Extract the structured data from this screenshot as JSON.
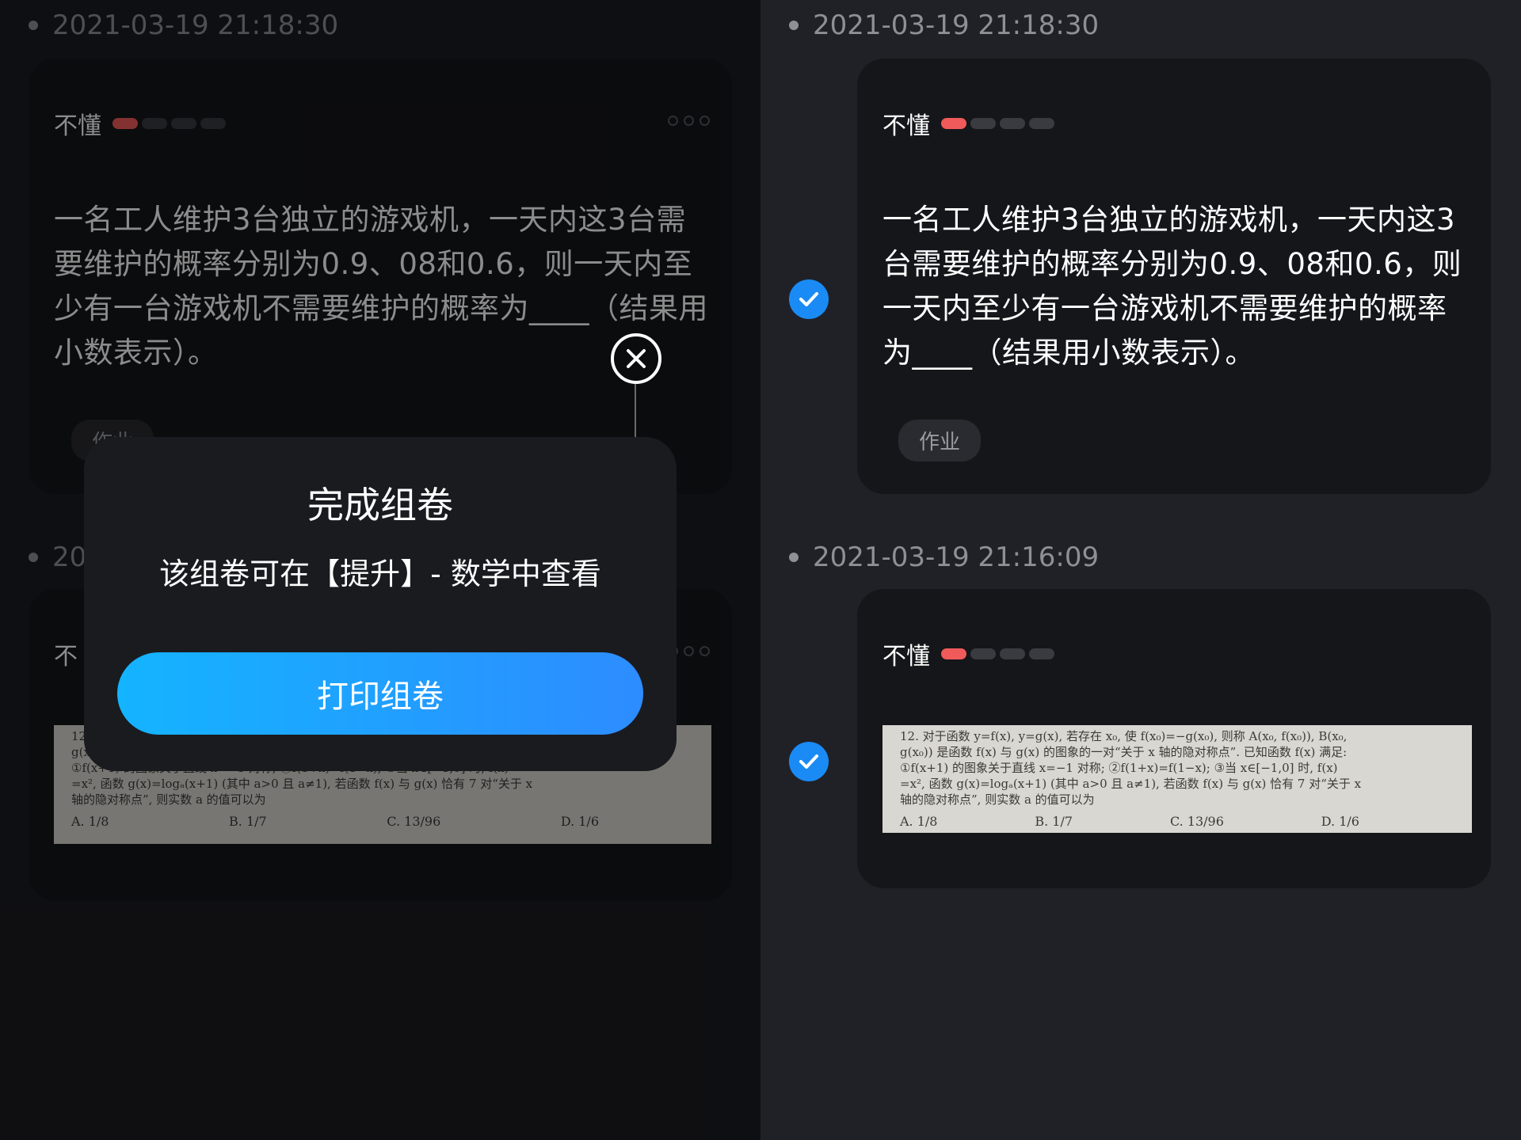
{
  "left": {
    "entry1": {
      "timestamp": "2021-03-19 21:18:30",
      "status_label": "不懂",
      "question": "一名工人维护3台独立的游戏机，一天内这3台需要维护的概率分别为0.9、08和0.6，则一天内至少有一台游戏机不需要维护的概率为____（结果用小数表示）。",
      "tag": "作业"
    },
    "entry2": {
      "timestamp_partial": "20",
      "status_label_partial": "不"
    }
  },
  "dialog": {
    "title": "完成组卷",
    "message": "该组卷可在【提升】- 数学中查看",
    "button": "打印组卷",
    "close_icon": "close-circle-icon"
  },
  "right": {
    "entry1": {
      "timestamp": "2021-03-19 21:18:30",
      "status_label": "不懂",
      "question": "一名工人维护3台独立的游戏机，一天内这3台需要维护的概率分别为0.9、08和0.6，则一天内至少有一台游戏机不需要维护的概率为____（结果用小数表示）。",
      "tag": "作业",
      "checked": true
    },
    "entry2": {
      "timestamp": "2021-03-19 21:16:09",
      "status_label": "不懂",
      "checked": true,
      "photo": {
        "line1": "12. 对于函数 y=f(x), y=g(x), 若存在 x₀, 使 f(x₀)=−g(x₀), 则称 A(x₀, f(x₀)), B(x₀,",
        "line2": "g(x₀)) 是函数 f(x) 与 g(x) 的图象的一对“关于 x 轴的隐对称点”. 已知函数 f(x) 满足:",
        "line3": "①f(x+1) 的图象关于直线 x=−1 对称; ②f(1+x)=f(1−x); ③当 x∈[−1,0] 时, f(x)",
        "line4": "=x², 函数 g(x)=logₐ(x+1) (其中 a>0 且 a≠1), 若函数 f(x) 与 g(x) 恰有 7 对“关于 x",
        "line5": "轴的隐对称点”, 则实数 a 的值可以为",
        "choices": [
          "A. 1/8",
          "B. 1/7",
          "C. 13/96",
          "D. 1/6"
        ]
      }
    }
  },
  "colors": {
    "accent_blue": "#1a8bf5",
    "status_red": "#f05a5a",
    "button_gradient_start": "#14b4ff",
    "button_gradient_end": "#2d8cff"
  }
}
